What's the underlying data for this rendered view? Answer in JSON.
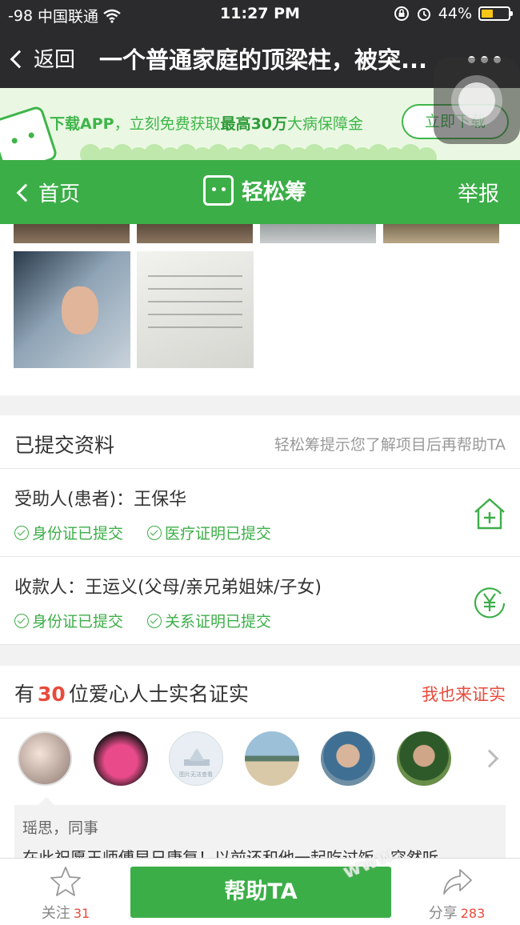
{
  "status_bar": {
    "signal": "-98",
    "carrier": "中国联通",
    "time": "11:27 PM",
    "battery": "44%",
    "battery_level": 0.44
  },
  "nav": {
    "back_label": "返回",
    "title": "一个普通家庭的顶梁柱，被突..."
  },
  "download_banner": {
    "text_prefix": "下载APP",
    "text_middle": "，立刻免费获取",
    "text_highlight": "最高30万",
    "text_suffix": "大病保障金",
    "button": "立即下载"
  },
  "header": {
    "home_label": "首页",
    "brand": "轻松筹",
    "report_label": "举报"
  },
  "submitted": {
    "title": "已提交资料",
    "hint": "轻松筹提示您了解项目后再帮助TA",
    "rows": [
      {
        "label": "受助人(患者)：王保华",
        "badges": [
          "身份证已提交",
          "医疗证明已提交"
        ],
        "icon": "medical-house-icon"
      },
      {
        "label": "收款人：王运义(父母/亲兄弟姐妹/子女)",
        "badges": [
          "身份证已提交",
          "关系证明已提交"
        ],
        "icon": "yuan-icon"
      }
    ]
  },
  "verify": {
    "title_prefix": "有",
    "count": "30",
    "title_suffix": "位爱心人士实名证实",
    "action": "我也来证实",
    "placeholder_avatar_caption": "图片无法查看",
    "comment": {
      "author": "瑶思，同事",
      "text": "在此祝愿王师傅早日康复！以前还和他一起吃过饭，突然听"
    }
  },
  "bottom_bar": {
    "follow_label": "关注",
    "follow_count": "31",
    "help_button": "帮助TA",
    "share_label": "分享",
    "share_count": "283"
  },
  "watermark": "www."
}
